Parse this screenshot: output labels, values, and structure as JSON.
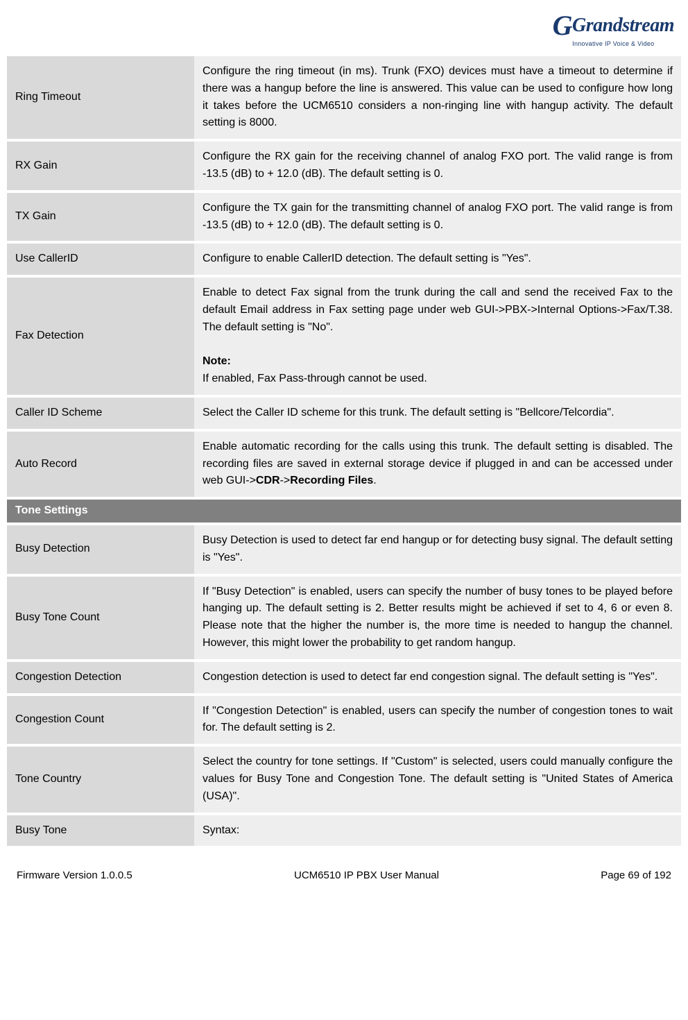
{
  "logo": {
    "brand": "Grandstream",
    "tagline": "Innovative IP Voice & Video"
  },
  "rows": [
    {
      "label": "Ring Timeout",
      "desc": "Configure the ring timeout (in ms). Trunk (FXO) devices must have a timeout to determine if there was a hangup before the line is answered. This value can be used to configure how long it takes before the UCM6510 considers a non-ringing line with hangup activity. The default setting is 8000."
    },
    {
      "label": "RX Gain",
      "desc": "Configure the RX gain for the receiving channel of analog FXO port. The valid range is from -13.5 (dB) to + 12.0 (dB). The default setting is 0."
    },
    {
      "label": "TX Gain",
      "desc": "Configure the TX gain for the transmitting channel of analog FXO port. The valid range is from -13.5 (dB) to + 12.0 (dB). The default setting is 0."
    },
    {
      "label": "Use CallerID",
      "desc": "Configure to enable CallerID detection. The default setting is \"Yes\"."
    },
    {
      "label": "Fax Detection",
      "desc_main": "Enable to detect Fax signal from the trunk during the call and send the received Fax to the default Email address in Fax setting page under web GUI->PBX->Internal Options->Fax/T.38. The default setting is \"No\".",
      "note_title": "Note:",
      "note_body": "If enabled, Fax Pass-through cannot be used."
    },
    {
      "label": "Caller ID Scheme",
      "desc": "Select the Caller ID scheme for this trunk. The default setting is \"Bellcore/Telcordia\"."
    },
    {
      "label": "Auto Record",
      "desc_pre": "Enable automatic recording for the calls using this trunk. The default setting is disabled. The recording files are saved in external storage device if plugged in and can be accessed under web GUI->",
      "desc_bold1": "CDR",
      "desc_mid": "->",
      "desc_bold2": "Recording Files",
      "desc_post": "."
    }
  ],
  "section": {
    "title": "Tone Settings"
  },
  "rows2": [
    {
      "label": "Busy Detection",
      "desc": "Busy Detection is used to detect far end hangup or for detecting busy signal. The default setting is \"Yes\"."
    },
    {
      "label": "Busy Tone Count",
      "desc": "If \"Busy Detection\" is enabled, users can specify the number of busy tones to be played before hanging up. The default setting is 2. Better results might be achieved if set to 4, 6 or even 8. Please note that the higher the number is, the more time is needed to hangup the channel. However, this might lower the probability to get random hangup."
    },
    {
      "label": "Congestion Detection",
      "desc": "Congestion detection is used to detect far end congestion signal. The default setting is \"Yes\"."
    },
    {
      "label": "Congestion Count",
      "desc": "If \"Congestion Detection\" is enabled, users can specify the number of congestion tones to wait for. The default setting is 2."
    },
    {
      "label": "Tone Country",
      "desc": "Select the country for tone settings. If \"Custom\" is selected, users could manually configure the values for Busy Tone and Congestion Tone. The default setting is \"United States of America (USA)\"."
    },
    {
      "label": "Busy Tone",
      "desc": "Syntax:"
    }
  ],
  "footer": {
    "version": "Firmware Version 1.0.0.5",
    "title": "UCM6510 IP PBX User Manual",
    "page": "Page 69 of 192"
  }
}
